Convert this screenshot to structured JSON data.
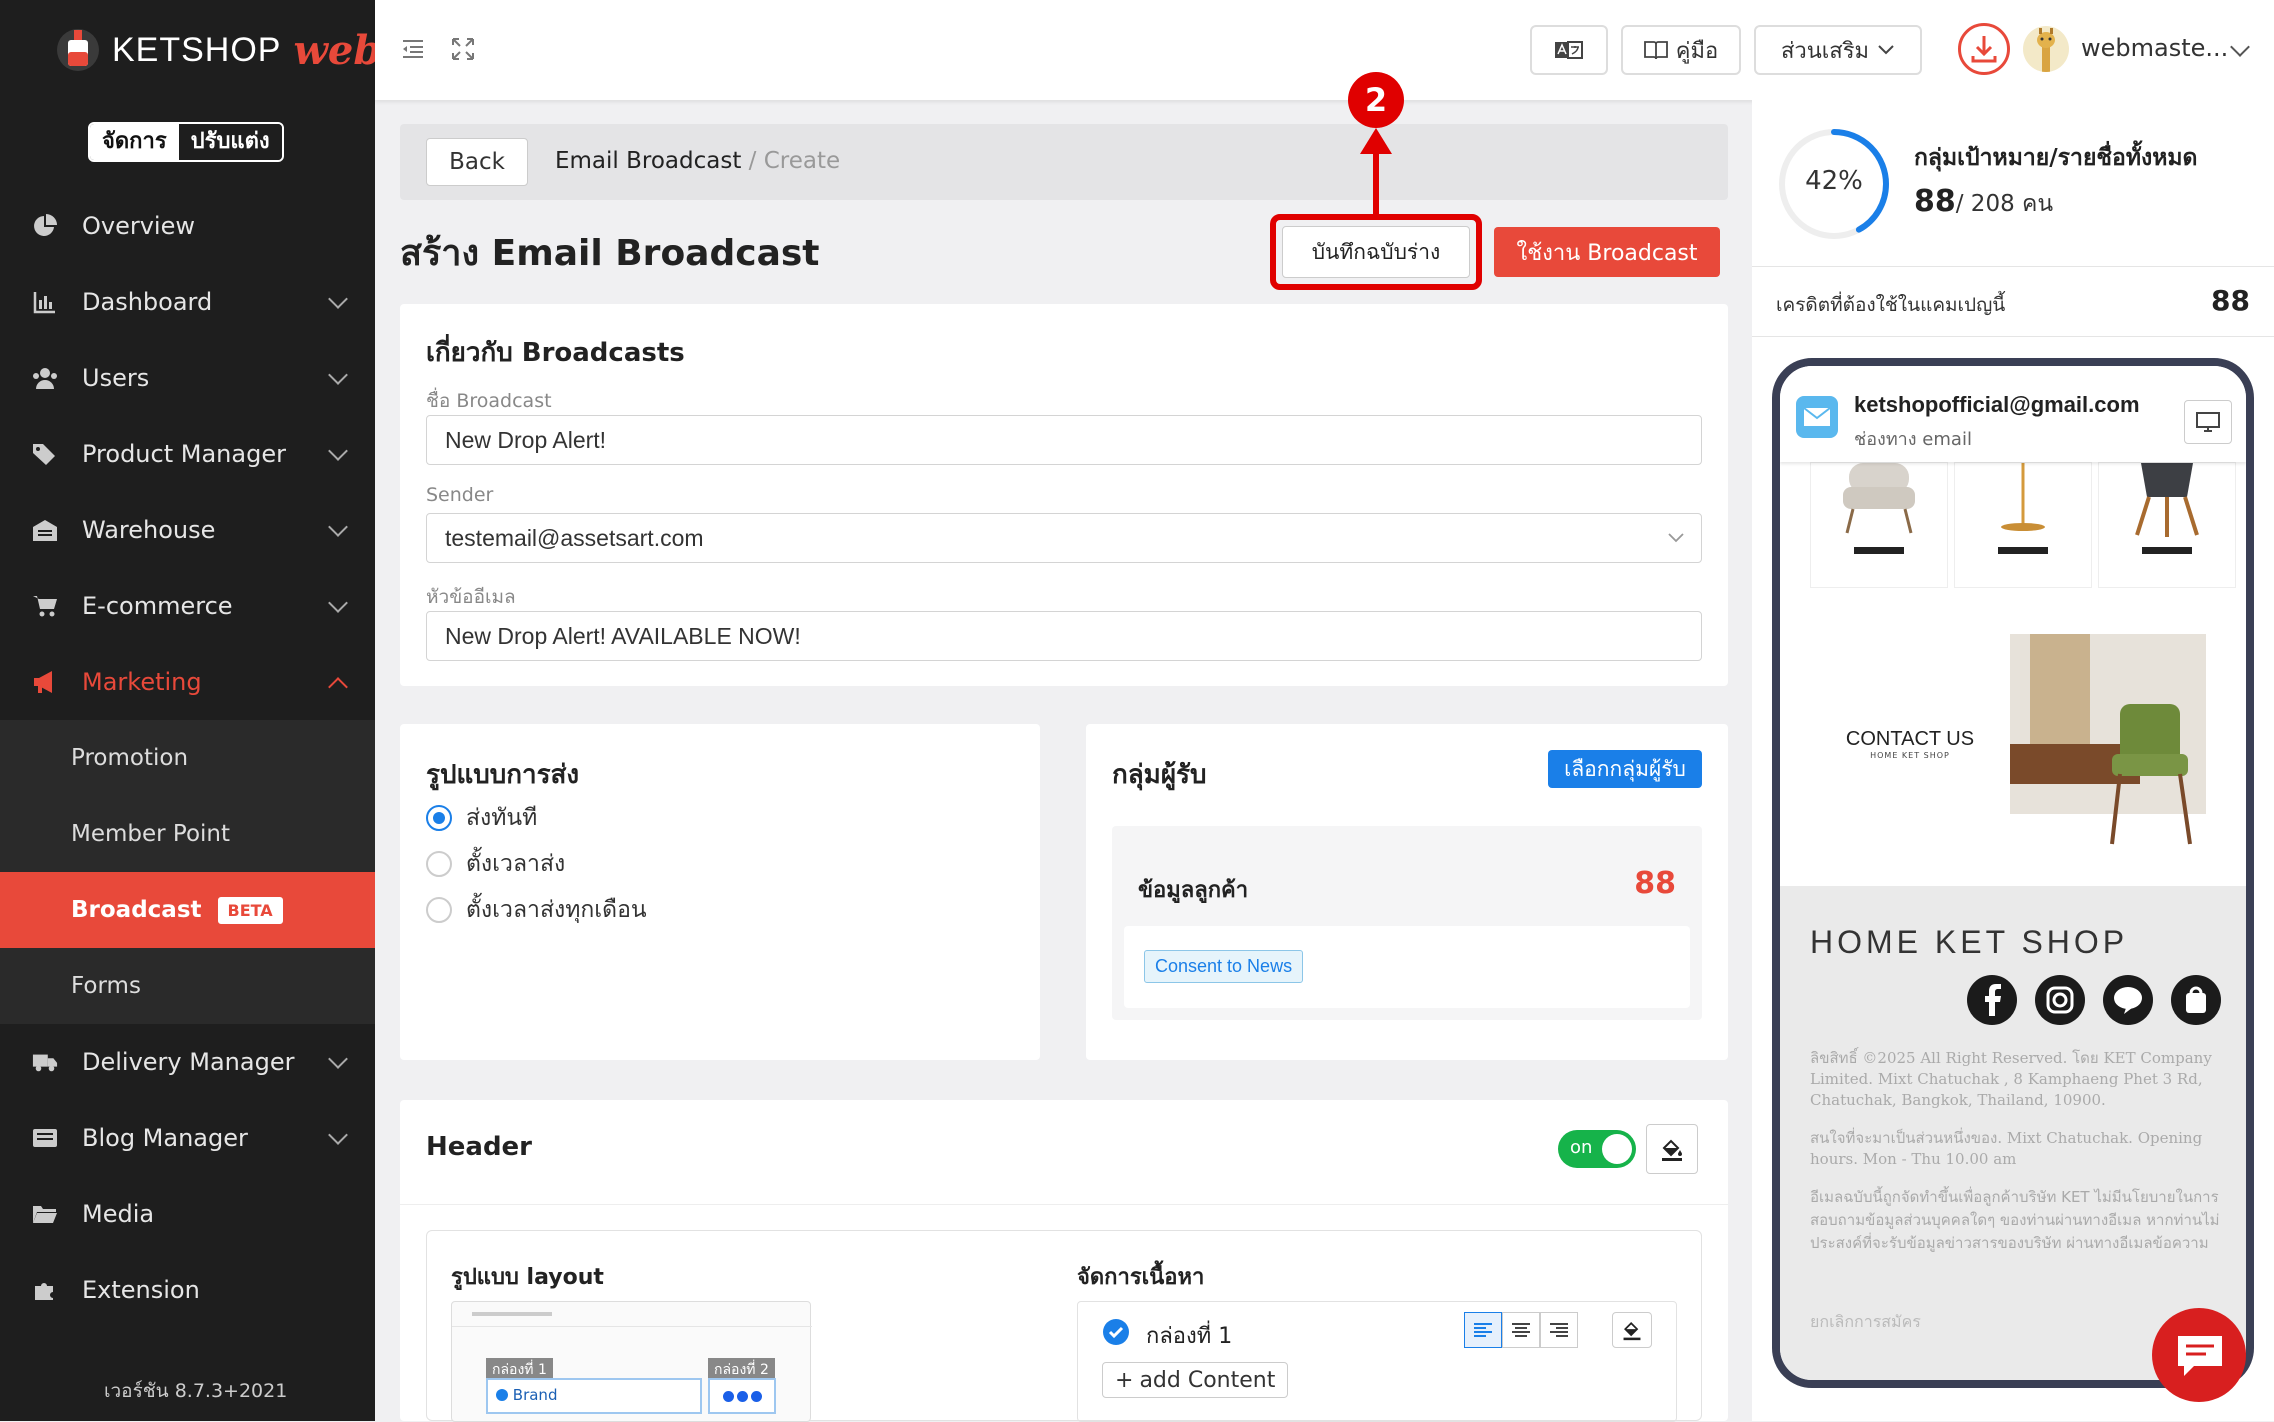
{
  "sidebar": {
    "logo_text": "KETSHOP",
    "logo_script": "web",
    "mode_manage": "จัดการ",
    "mode_customize": "ปรับแต่ง",
    "items": [
      {
        "label": "Overview"
      },
      {
        "label": "Dashboard"
      },
      {
        "label": "Users"
      },
      {
        "label": "Product Manager"
      },
      {
        "label": "Warehouse"
      },
      {
        "label": "E-commerce"
      },
      {
        "label": "Marketing"
      }
    ],
    "marketing_sub": [
      {
        "label": "Promotion"
      },
      {
        "label": "Member Point"
      },
      {
        "label": "Broadcast",
        "badge": "BETA"
      },
      {
        "label": "Forms"
      }
    ],
    "items_after": [
      {
        "label": "Delivery Manager"
      },
      {
        "label": "Blog Manager"
      },
      {
        "label": "Media"
      },
      {
        "label": "Extension"
      }
    ],
    "version": "เวอร์ชัน 8.7.3+2021"
  },
  "topbar": {
    "manual_label": "คู่มือ",
    "addons_label": "ส่วนเสริม",
    "username": "webmaste..."
  },
  "breadcrumb": {
    "back_label": "Back",
    "parent": "Email Broadcast",
    "separator": "/",
    "current": "Create"
  },
  "page": {
    "title": "สร้าง Email Broadcast",
    "save_draft_label": "บันทึกฉบับร่าง",
    "use_broadcast_label": "ใช้งาน Broadcast",
    "annotation_number": "2"
  },
  "about": {
    "heading": "เกี่ยวกับ Broadcasts",
    "name_label": "ชื่อ Broadcast",
    "name_value": "New Drop Alert!",
    "sender_label": "Sender",
    "sender_value": "testemail@assetsart.com",
    "subject_label": "หัวข้ออีเมล",
    "subject_value": "New Drop Alert! AVAILABLE NOW!"
  },
  "send_type": {
    "heading": "รูปแบบการส่ง",
    "options": [
      "ส่งทันที",
      "ตั้งเวลาส่ง",
      "ตั้งเวลาส่งทุกเดือน"
    ],
    "selected_index": 0
  },
  "recipients": {
    "heading": "กลุ่มผู้รับ",
    "select_button": "เลือกกลุ่มผู้รับ",
    "customer_label": "ข้อมูลลูกค้า",
    "customer_count": "88",
    "tag": "Consent to News"
  },
  "header_section": {
    "title": "Header",
    "toggle_label": "on",
    "layout_heading": "รูปแบบ layout",
    "content_heading": "จัดการเนื้อหา",
    "box1_label": "กล่องที่ 1",
    "box2_label": "กล่องที่ 2",
    "brand_label": "Brand",
    "content_item": "กล่องที่ 1",
    "add_content": "add Content"
  },
  "right_panel": {
    "progress_percent": "42%",
    "progress_value": 42,
    "target_title": "กลุ่มเป้าหมาย/รายชื่อทั้งหมด",
    "target_count": "88",
    "target_total": "/ 208 คน",
    "credit_label": "เครดิตที่ต้องใช้ในแคมเปญนี้",
    "credit_value": "88"
  },
  "preview": {
    "email": "ketshopofficial@gmail.com",
    "channel": "ช่องทาง email",
    "contact": "CONTACT US",
    "contact_sub": "HOME KET SHOP",
    "brand": "HOME KET SHOP",
    "copyright": "ลิขสิทธิ์ ©2025 All Right Reserved. โดย KET Company Limited. Mixt Chatuchak , 8 Kamphaeng Phet 3 Rd, Chatuchak, Bangkok, Thailand, 10900.",
    "hours": "สนใจที่จะมาเป็นส่วนหนึ่งของ. Mixt Chatuchak. Opening hours. Mon - Thu 10.00 am",
    "notice": "อีเมลฉบับนี้ถูกจัดทำขึ้นเพื่อลูกค้าบริษัท KET ไม่มีนโยบายในการสอบถามข้อมูลส่วนบุคคลใดๆ ของท่านผ่านทางอีเมล หากท่านไม่ประสงค์ที่จะรับข้อมูลข่าวสารของบริษัท ผ่านทางอีเมลข้อความ",
    "unsubscribe": "ยกเลิกการสมัคร"
  },
  "colors": {
    "accent": "#e8493a",
    "sidebar_bg": "#1e1e1e",
    "primary_blue": "#1a7fe8",
    "annotation_red": "#e00000",
    "toggle_green": "#16b34a"
  }
}
